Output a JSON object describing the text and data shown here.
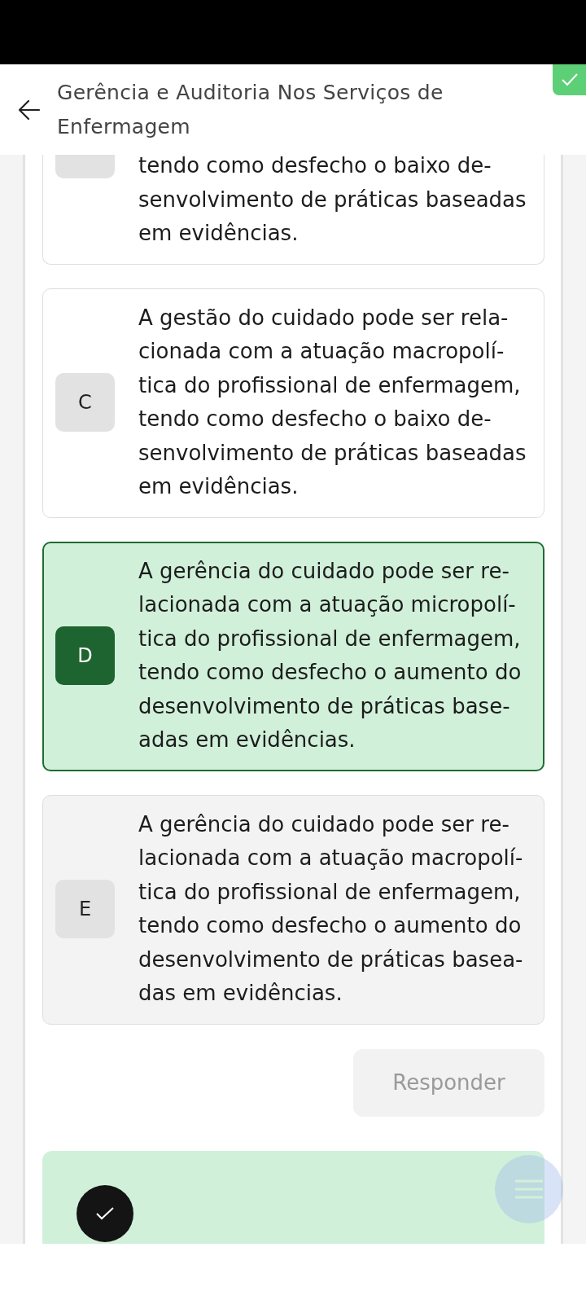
{
  "header": {
    "title": "Gerência e Auditoria Nos Serviços de Enfermagem",
    "answered": true
  },
  "options": [
    {
      "text": "tendo como desfecho o baixo de-\nsenvolvimento de práticas baseadas\nem evidências.",
      "selected": false,
      "hovered": false,
      "clipped": true
    },
    {
      "letter": "C",
      "text": "A gestão do cuidado pode ser rela-\ncionada com a atuação macropolí-\ntica do profissional de enfermagem,\ntendo como desfecho o baixo de-\nsenvolvimento de práticas baseadas\nem evidências.",
      "selected": false,
      "hovered": false,
      "clipped": false
    },
    {
      "letter": "D",
      "text": "A gerência do cuidado pode ser re-\nlacionada com a atuação micropolí-\ntica do profissional de enfermagem,\ntendo como desfecho o aumento do\ndesenvolvimento de práticas base-\nadas em evidências.",
      "selected": true,
      "hovered": false,
      "clipped": false
    },
    {
      "letter": "E",
      "text": "A gerência do cuidado pode ser re-\nlacionada com a atuação macropolí-\ntica do profissional de enfermagem,\ntendo como desfecho o aumento do\ndesenvolvimento de práticas basea-\ndas em evidências.",
      "selected": false,
      "hovered": true,
      "clipped": false
    }
  ],
  "submit_button": {
    "label": "Responder",
    "disabled": true
  },
  "feedback": {
    "correct": true
  }
}
